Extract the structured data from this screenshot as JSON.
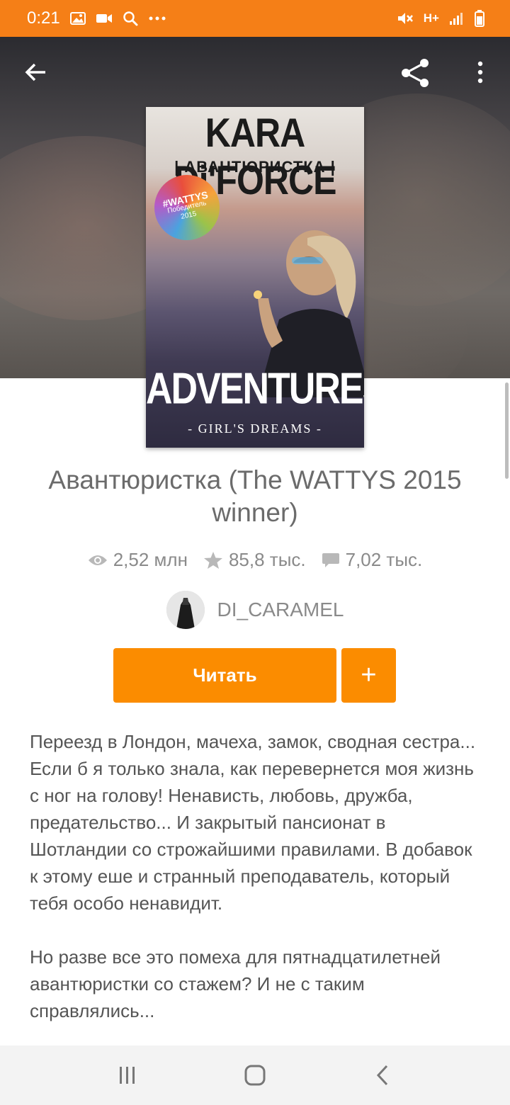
{
  "status_bar": {
    "time": "0:21",
    "left_icons": [
      "image-icon",
      "video-icon",
      "search-icon",
      "more-dots-icon"
    ],
    "right_icons": [
      "mute-icon",
      "network-type-icon",
      "signal-icon",
      "battery-icon"
    ],
    "network_label": "H+"
  },
  "toolbar": {
    "back_icon": "arrow-left-icon",
    "share_icon": "share-icon",
    "more_icon": "more-vertical-icon"
  },
  "cover": {
    "author_text": "KARA Di'FORCE",
    "subtitle_text": "| АВАНТЮРИСТКА |",
    "badge_line1": "#WATTYS",
    "badge_line2": "Победитель",
    "badge_line3": "2015",
    "title_text": "ADVENTURESS",
    "tagline_text": "- GIRL'S DREAMS -"
  },
  "book": {
    "title": "Авантюристка (The WATTYS 2015 winner)",
    "stats": {
      "reads": "2,52 млн",
      "votes": "85,8 тыс.",
      "comments": "7,02 тыс."
    },
    "author": "DI_CARAMEL",
    "read_button_label": "Читать",
    "add_button_label": "+",
    "description": [
      "Переезд в Лондон, мачеха, замок, сводная сестра...\nЕсли б я только знала, как перевернется моя жизнь с ног на голову! Ненависть, любовь, дружба, предательство... И закрытый пансионат в Шотландии со строжайшими правилами. В добавок к этому еше и странный преподаватель, который тебя особо ненавидит.",
      "Но разве все это помеха для пятнадцатилетней авантюристки со стажем? И не с таким справлялись..."
    ]
  },
  "nav_bar": {
    "recents_icon": "recents-icon",
    "home_icon": "home-icon",
    "back_icon": "back-chevron-icon"
  },
  "colors": {
    "status_bar": "#f57f17",
    "accent": "#fb8c00",
    "text_muted": "#8a8a8a"
  }
}
